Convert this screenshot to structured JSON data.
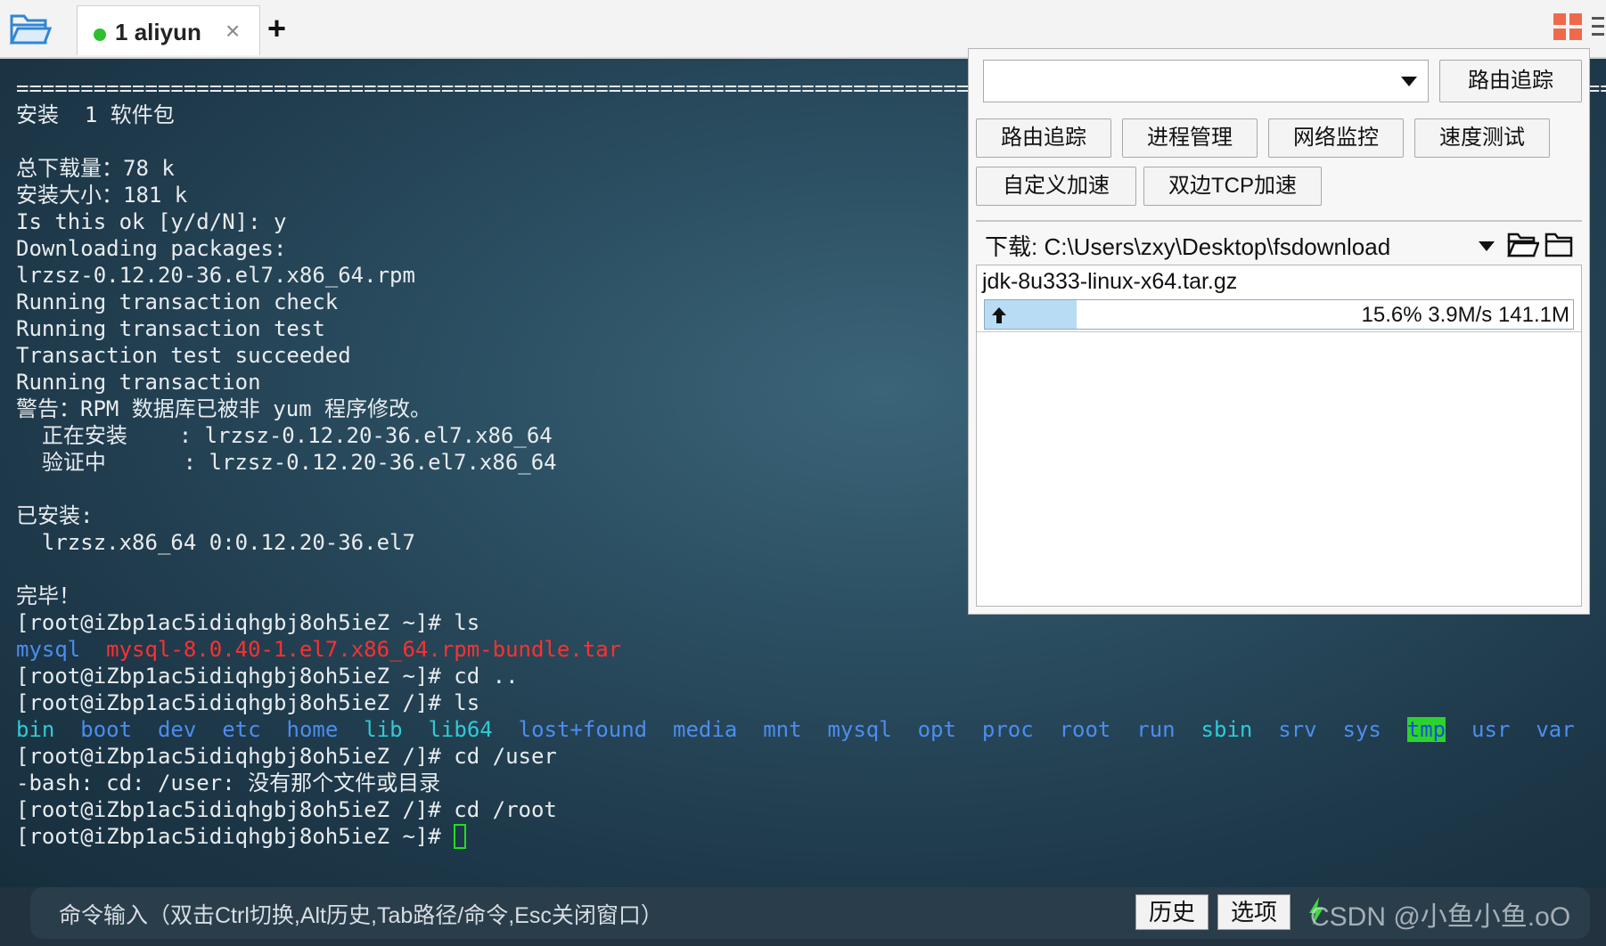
{
  "tabbar": {
    "tab_index": "1",
    "tab_title": "aliyun",
    "close_glyph": "×",
    "add_glyph": "+"
  },
  "terminal": {
    "lines": [
      [
        {
          "t": "==========================================================================================================================================================================================================="
        }
      ],
      [
        {
          "t": "安装  1 软件包"
        }
      ],
      [
        {
          "t": ""
        }
      ],
      [
        {
          "t": "总下载量：78 k"
        }
      ],
      [
        {
          "t": "安装大小：181 k"
        }
      ],
      [
        {
          "t": "Is this ok [y/d/N]: y"
        }
      ],
      [
        {
          "t": "Downloading packages:"
        }
      ],
      [
        {
          "t": "lrzsz-0.12.20-36.el7.x86_64.rpm"
        }
      ],
      [
        {
          "t": "Running transaction check"
        }
      ],
      [
        {
          "t": "Running transaction test"
        }
      ],
      [
        {
          "t": "Transaction test succeeded"
        }
      ],
      [
        {
          "t": "Running transaction"
        }
      ],
      [
        {
          "t": "警告：RPM 数据库已被非 yum 程序修改。"
        }
      ],
      [
        {
          "t": "  正在安装    : lrzsz-0.12.20-36.el7.x86_64"
        }
      ],
      [
        {
          "t": "  验证中      : lrzsz-0.12.20-36.el7.x86_64"
        }
      ],
      [
        {
          "t": ""
        }
      ],
      [
        {
          "t": "已安装:"
        }
      ],
      [
        {
          "t": "  lrzsz.x86_64 0:0.12.20-36.el7"
        }
      ],
      [
        {
          "t": ""
        }
      ],
      [
        {
          "t": "完毕！"
        }
      ],
      [
        {
          "t": "[root@iZbp1ac5idiqhgbj8oh5ieZ ~]# ls"
        }
      ],
      [
        {
          "t": "mysql",
          "c": "c-blue"
        },
        {
          "t": "  "
        },
        {
          "t": "mysql-8.0.40-1.el7.x86_64.rpm-bundle.tar",
          "c": "c-red"
        }
      ],
      [
        {
          "t": "[root@iZbp1ac5idiqhgbj8oh5ieZ ~]# cd .."
        }
      ],
      [
        {
          "t": "[root@iZbp1ac5idiqhgbj8oh5ieZ /]# ls"
        }
      ],
      [
        {
          "t": "bin",
          "c": "c-cyan"
        },
        {
          "t": "  "
        },
        {
          "t": "boot",
          "c": "c-blue"
        },
        {
          "t": "  "
        },
        {
          "t": "dev",
          "c": "c-blue"
        },
        {
          "t": "  "
        },
        {
          "t": "etc",
          "c": "c-blue"
        },
        {
          "t": "  "
        },
        {
          "t": "home",
          "c": "c-blue"
        },
        {
          "t": "  "
        },
        {
          "t": "lib",
          "c": "c-cyan"
        },
        {
          "t": "  "
        },
        {
          "t": "lib64",
          "c": "c-cyan"
        },
        {
          "t": "  "
        },
        {
          "t": "lost+found",
          "c": "c-blue"
        },
        {
          "t": "  "
        },
        {
          "t": "media",
          "c": "c-blue"
        },
        {
          "t": "  "
        },
        {
          "t": "mnt",
          "c": "c-blue"
        },
        {
          "t": "  "
        },
        {
          "t": "mysql",
          "c": "c-blue"
        },
        {
          "t": "  "
        },
        {
          "t": "opt",
          "c": "c-blue"
        },
        {
          "t": "  "
        },
        {
          "t": "proc",
          "c": "c-blue"
        },
        {
          "t": "  "
        },
        {
          "t": "root",
          "c": "c-blue"
        },
        {
          "t": "  "
        },
        {
          "t": "run",
          "c": "c-blue"
        },
        {
          "t": "  "
        },
        {
          "t": "sbin",
          "c": "c-cyan"
        },
        {
          "t": "  "
        },
        {
          "t": "srv",
          "c": "c-blue"
        },
        {
          "t": "  "
        },
        {
          "t": "sys",
          "c": "c-blue"
        },
        {
          "t": "  "
        },
        {
          "t": "tmp",
          "c": "c-tmp"
        },
        {
          "t": "  "
        },
        {
          "t": "usr",
          "c": "c-blue"
        },
        {
          "t": "  "
        },
        {
          "t": "var",
          "c": "c-blue"
        }
      ],
      [
        {
          "t": "[root@iZbp1ac5idiqhgbj8oh5ieZ /]# cd /user"
        }
      ],
      [
        {
          "t": "-bash: cd: /user: 没有那个文件或目录"
        }
      ],
      [
        {
          "t": "[root@iZbp1ac5idiqhgbj8oh5ieZ /]# cd /root"
        }
      ],
      [
        {
          "t": "[root@iZbp1ac5idiqhgbj8oh5ieZ ~]# "
        }
      ]
    ]
  },
  "panel": {
    "combo_value": "",
    "trace_button": "路由追踪",
    "tools": [
      "路由追踪",
      "进程管理",
      "网络监控",
      "速度测试",
      "自定义加速",
      "双边TCP加速"
    ],
    "download_label": "下载: C:\\Users\\zxy\\Desktop\\fsdownload",
    "transfer": {
      "file_name": "jdk-8u333-linux-x64.tar.gz",
      "progress_percent": 15.6,
      "stats": "15.6% 3.9M/s 141.1M"
    }
  },
  "cmdbar": {
    "placeholder": "命令输入（双击Ctrl切换,Alt历史,Tab路径/命令,Esc关闭窗口）",
    "history_button": "历史",
    "options_button": "选项",
    "watermark": "CSDN @小鱼小鱼.oO"
  },
  "colors": {
    "accent_green": "#2fbf2f",
    "dir_blue": "#4c8df0",
    "archive_red": "#ff3030",
    "link_cyan": "#2ecbd6",
    "progress_fill": "#b9dcf5"
  },
  "icons": [
    "folder-open-icon",
    "close-icon",
    "plus-icon",
    "grid-icon",
    "menu-icon",
    "chevron-down-icon",
    "folder-icon",
    "upload-arrow-icon",
    "lightning-icon"
  ]
}
